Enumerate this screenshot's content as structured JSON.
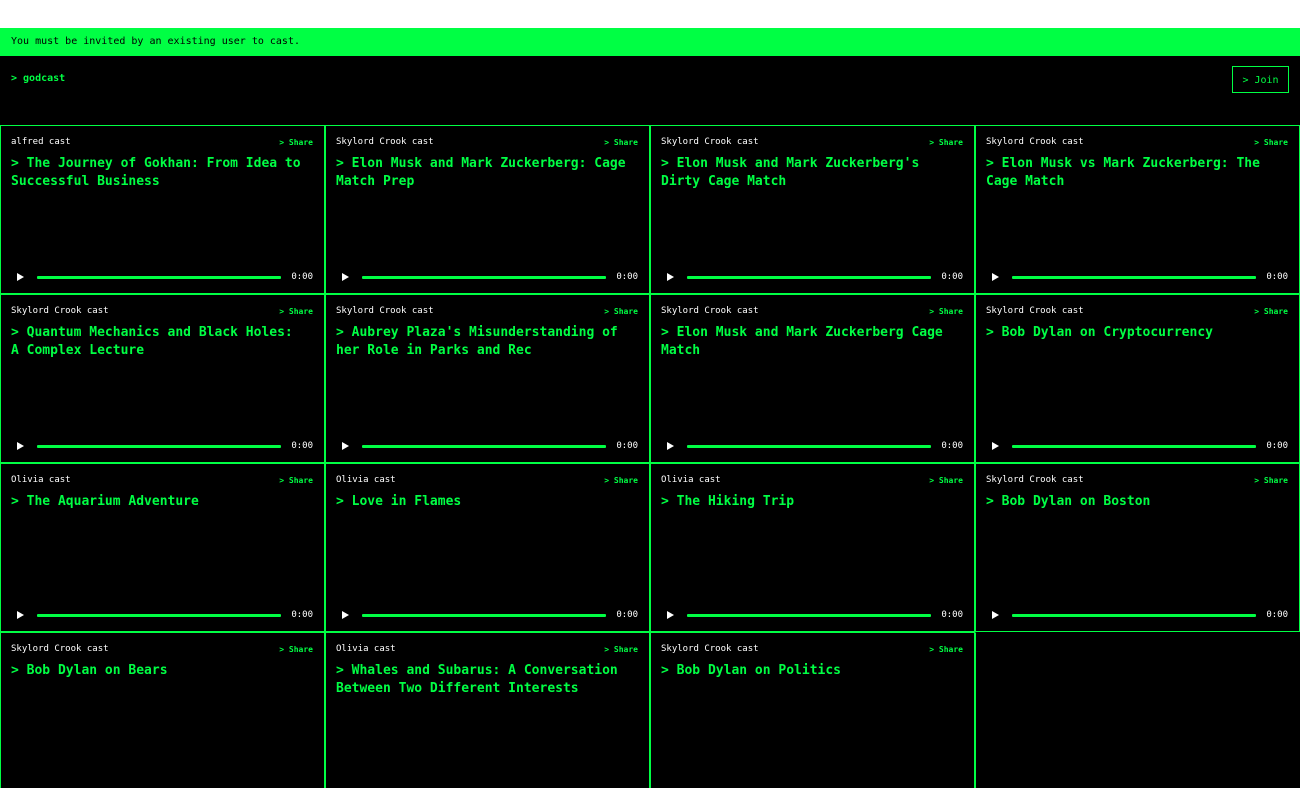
{
  "banner": {
    "text": "You must be invited by an existing user to cast."
  },
  "header": {
    "brand": "> godcast",
    "join_label": "> Join"
  },
  "share_label": "> Share",
  "casts": [
    {
      "author": "alfred cast",
      "title": "> The Journey of Gokhan: From Idea to Successful Business",
      "time": "0:00"
    },
    {
      "author": "Skylord Crook cast",
      "title": "> Elon Musk and Mark Zuckerberg: Cage Match Prep",
      "time": "0:00"
    },
    {
      "author": "Skylord Crook cast",
      "title": "> Elon Musk and Mark Zuckerberg's Dirty Cage Match",
      "time": "0:00"
    },
    {
      "author": "Skylord Crook cast",
      "title": "> Elon Musk vs Mark Zuckerberg: The Cage Match",
      "time": "0:00"
    },
    {
      "author": "Skylord Crook cast",
      "title": "> Quantum Mechanics and Black Holes: A Complex Lecture",
      "time": "0:00"
    },
    {
      "author": "Skylord Crook cast",
      "title": "> Aubrey Plaza's Misunderstanding of her Role in Parks and Rec",
      "time": "0:00"
    },
    {
      "author": "Skylord Crook cast",
      "title": "> Elon Musk and Mark Zuckerberg Cage Match",
      "time": "0:00"
    },
    {
      "author": "Skylord Crook cast",
      "title": "> Bob Dylan on Cryptocurrency",
      "time": "0:00"
    },
    {
      "author": "Olivia cast",
      "title": "> The Aquarium Adventure",
      "time": "0:00"
    },
    {
      "author": "Olivia cast",
      "title": "> Love in Flames",
      "time": "0:00"
    },
    {
      "author": "Olivia cast",
      "title": "> The Hiking Trip",
      "time": "0:00"
    },
    {
      "author": "Skylord Crook cast",
      "title": "> Bob Dylan on Boston",
      "time": "0:00"
    },
    {
      "author": "Skylord Crook cast",
      "title": "> Bob Dylan on Bears",
      "time": ""
    },
    {
      "author": "Olivia cast",
      "title": "> Whales and Subarus: A Conversation Between Two Different Interests",
      "time": ""
    },
    {
      "author": "Skylord Crook cast",
      "title": "> Bob Dylan on Politics",
      "time": ""
    }
  ],
  "colors": {
    "accent": "#00ff44",
    "background": "#000000",
    "text": "#ffffff"
  }
}
